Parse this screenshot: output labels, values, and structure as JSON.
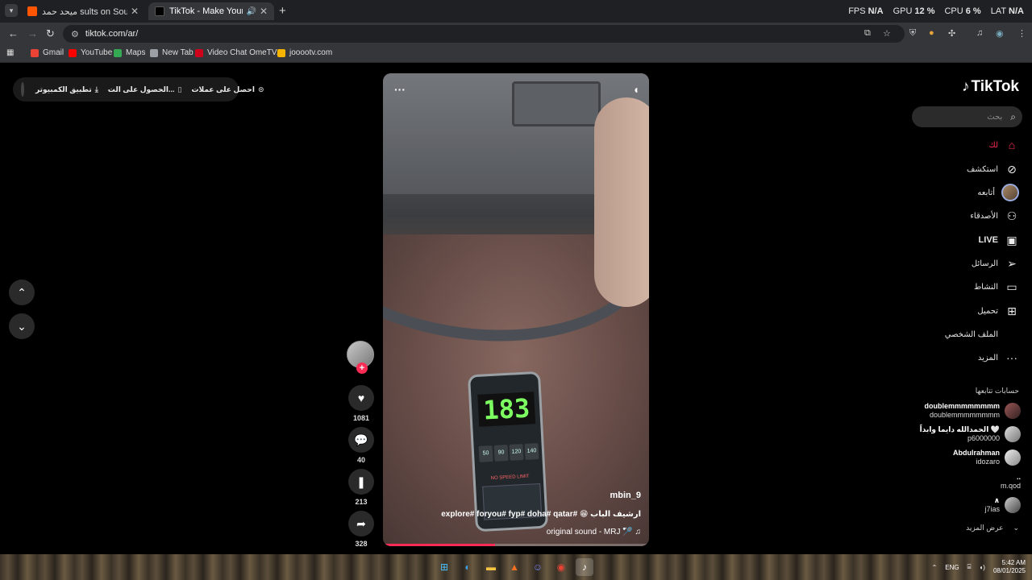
{
  "browser": {
    "tabs": [
      {
        "title": "ميحد حمد sults on SoundCloud",
        "favicon_color": "#ff5500",
        "active": false
      },
      {
        "title": "TikTok - Make Your Day",
        "favicon_color": "#000000",
        "active": true
      }
    ],
    "perf": {
      "fps_label": "FPS",
      "fps_value": "N/A",
      "gpu_label": "GPU",
      "gpu_value": "12 %",
      "cpu_label": "CPU",
      "cpu_value": "6 %",
      "lat_label": "LAT",
      "lat_value": "N/A"
    },
    "url": "tiktok.com/ar/",
    "bookmarks": [
      {
        "label": "Gmail",
        "color": "#ea4335"
      },
      {
        "label": "YouTube",
        "color": "#ff0000"
      },
      {
        "label": "Maps",
        "color": "#34a853"
      },
      {
        "label": "New Tab",
        "color": "#9aa0a6"
      },
      {
        "label": "Video Chat OmeTV...",
        "color": "#d0021b"
      },
      {
        "label": "jooootv.com",
        "color": "#f4b400"
      }
    ]
  },
  "promo": {
    "desktop_app": "تطبيق الكمبيوتر",
    "get_app": "الحصول على الت...",
    "get_coins": "احصل على عملات"
  },
  "video": {
    "username": "mbin_9",
    "caption": "explore# foryou# fyp# doha# qatar# 😁 ارشيف الباب",
    "sound": "original sound - MRJ 🏸",
    "speed": "183",
    "limits": [
      "50",
      "90",
      "120",
      "140"
    ],
    "no_limit": "NO SPEED LIMIT",
    "progress": 0.42
  },
  "actions": {
    "likes": "1081",
    "comments": "40",
    "saves": "213",
    "shares": "328"
  },
  "sidebar": {
    "logo": "TikTok",
    "search_placeholder": "بحث",
    "nav": [
      {
        "label": "لك",
        "icon": "home-icon",
        "active": true
      },
      {
        "label": "استكشف",
        "icon": "compass-icon"
      },
      {
        "label": "أتابعه",
        "icon": "avatar"
      },
      {
        "label": "الأصدقاء",
        "icon": "friends-icon"
      },
      {
        "label": "LIVE",
        "icon": "live-icon"
      },
      {
        "label": "الرسائل",
        "icon": "send-icon"
      },
      {
        "label": "النشاط",
        "icon": "activity-icon"
      },
      {
        "label": "تحميل",
        "icon": "upload-icon"
      },
      {
        "label": "الملف الشخصي",
        "icon": "profile-icon"
      },
      {
        "label": "المزيد",
        "icon": "more-icon"
      }
    ],
    "following_title": "حسابات تتابعها",
    "accounts": [
      {
        "name": "doublemmmmmmmm",
        "handle": "doublemmmmmmmm"
      },
      {
        "name": "الحمدالله دايما وابداً 🤍",
        "handle": "p6000000"
      },
      {
        "name": "Abdulrahman",
        "handle": "idozaro"
      },
      {
        "name": "..",
        "handle": "m.qod"
      },
      {
        "name": "∧",
        "handle": "j7ias"
      }
    ],
    "see_more": "عرض المزيد"
  },
  "taskbar": {
    "lang": "ENG",
    "time": "5:42 AM",
    "date": "08/01/2025"
  }
}
